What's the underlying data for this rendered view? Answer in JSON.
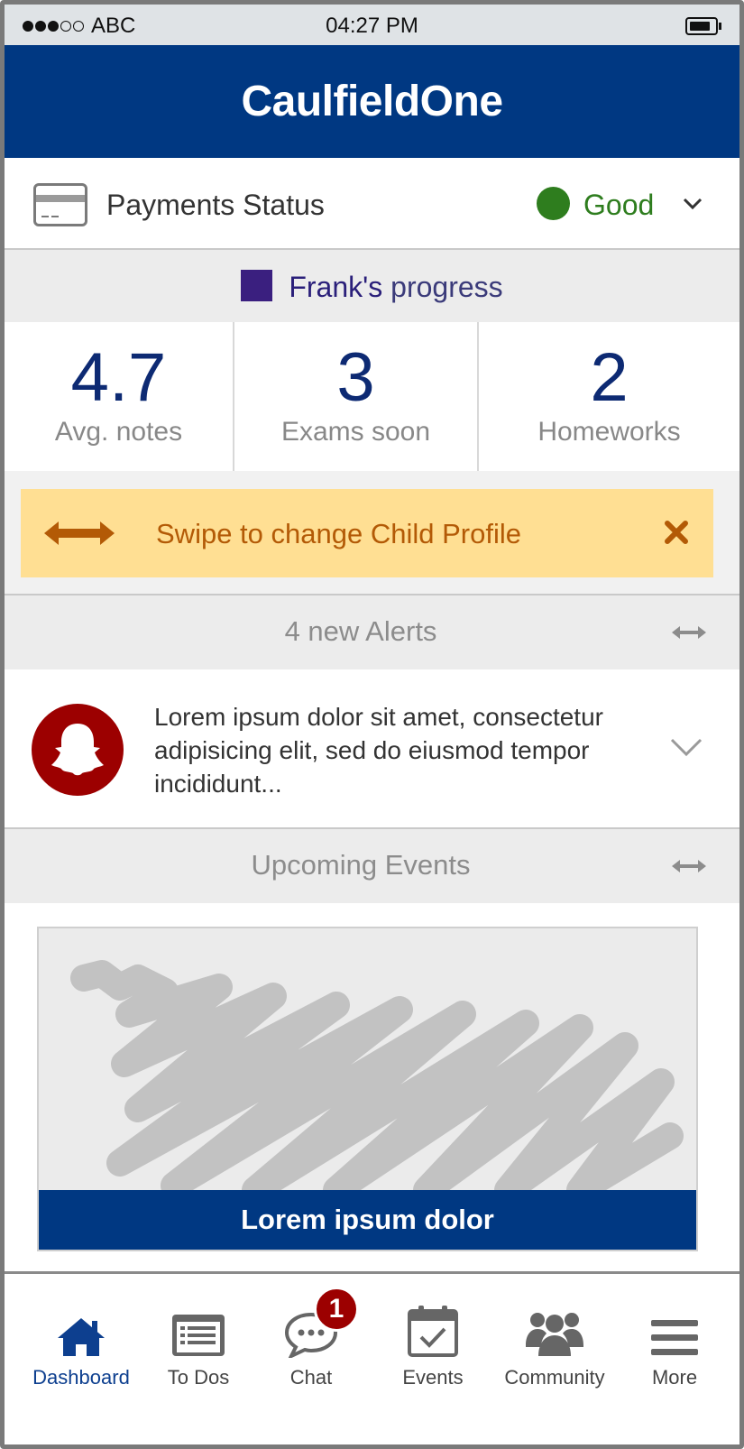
{
  "status_bar": {
    "carrier": "ABC",
    "time": "04:27 PM",
    "signal_filled": 3,
    "signal_total": 5
  },
  "header": {
    "title": "CaulfieldOne"
  },
  "payments": {
    "label": "Payments Status",
    "status": "Good",
    "status_color": "#2e7d1e",
    "icon": "credit-card-icon"
  },
  "progress": {
    "child_name": "Frank's",
    "suffix": "progress",
    "swatch_color": "#3a1f7f"
  },
  "stats": [
    {
      "value": "4.7",
      "label": "Avg. notes"
    },
    {
      "value": "3",
      "label": "Exams soon"
    },
    {
      "value": "2",
      "label": "Homeworks"
    }
  ],
  "swipe_banner": {
    "text": "Swipe to change Child Profile",
    "icon": "swap-arrows-icon",
    "close_icon": "close-icon"
  },
  "alerts": {
    "header": "4 new Alerts",
    "items": [
      {
        "text": "Lorem ipsum dolor sit amet, consectetur adipisicing elit, sed do eiusmod tempor incididunt...",
        "icon": "ghost-icon"
      }
    ]
  },
  "events": {
    "header": "Upcoming Events",
    "items": [
      {
        "title": "Lorem ipsum dolor"
      }
    ]
  },
  "tabs": [
    {
      "label": "Dashboard",
      "icon": "home-icon",
      "active": true
    },
    {
      "label": "To Dos",
      "icon": "list-icon"
    },
    {
      "label": "Chat",
      "icon": "chat-icon",
      "badge": "1"
    },
    {
      "label": "Events",
      "icon": "calendar-icon"
    },
    {
      "label": "Community",
      "icon": "community-icon"
    },
    {
      "label": "More",
      "icon": "menu-icon"
    }
  ],
  "colors": {
    "brand": "#003882",
    "alert_red": "#9c0000",
    "banner_bg": "#ffdf93",
    "banner_text": "#b35a06"
  }
}
